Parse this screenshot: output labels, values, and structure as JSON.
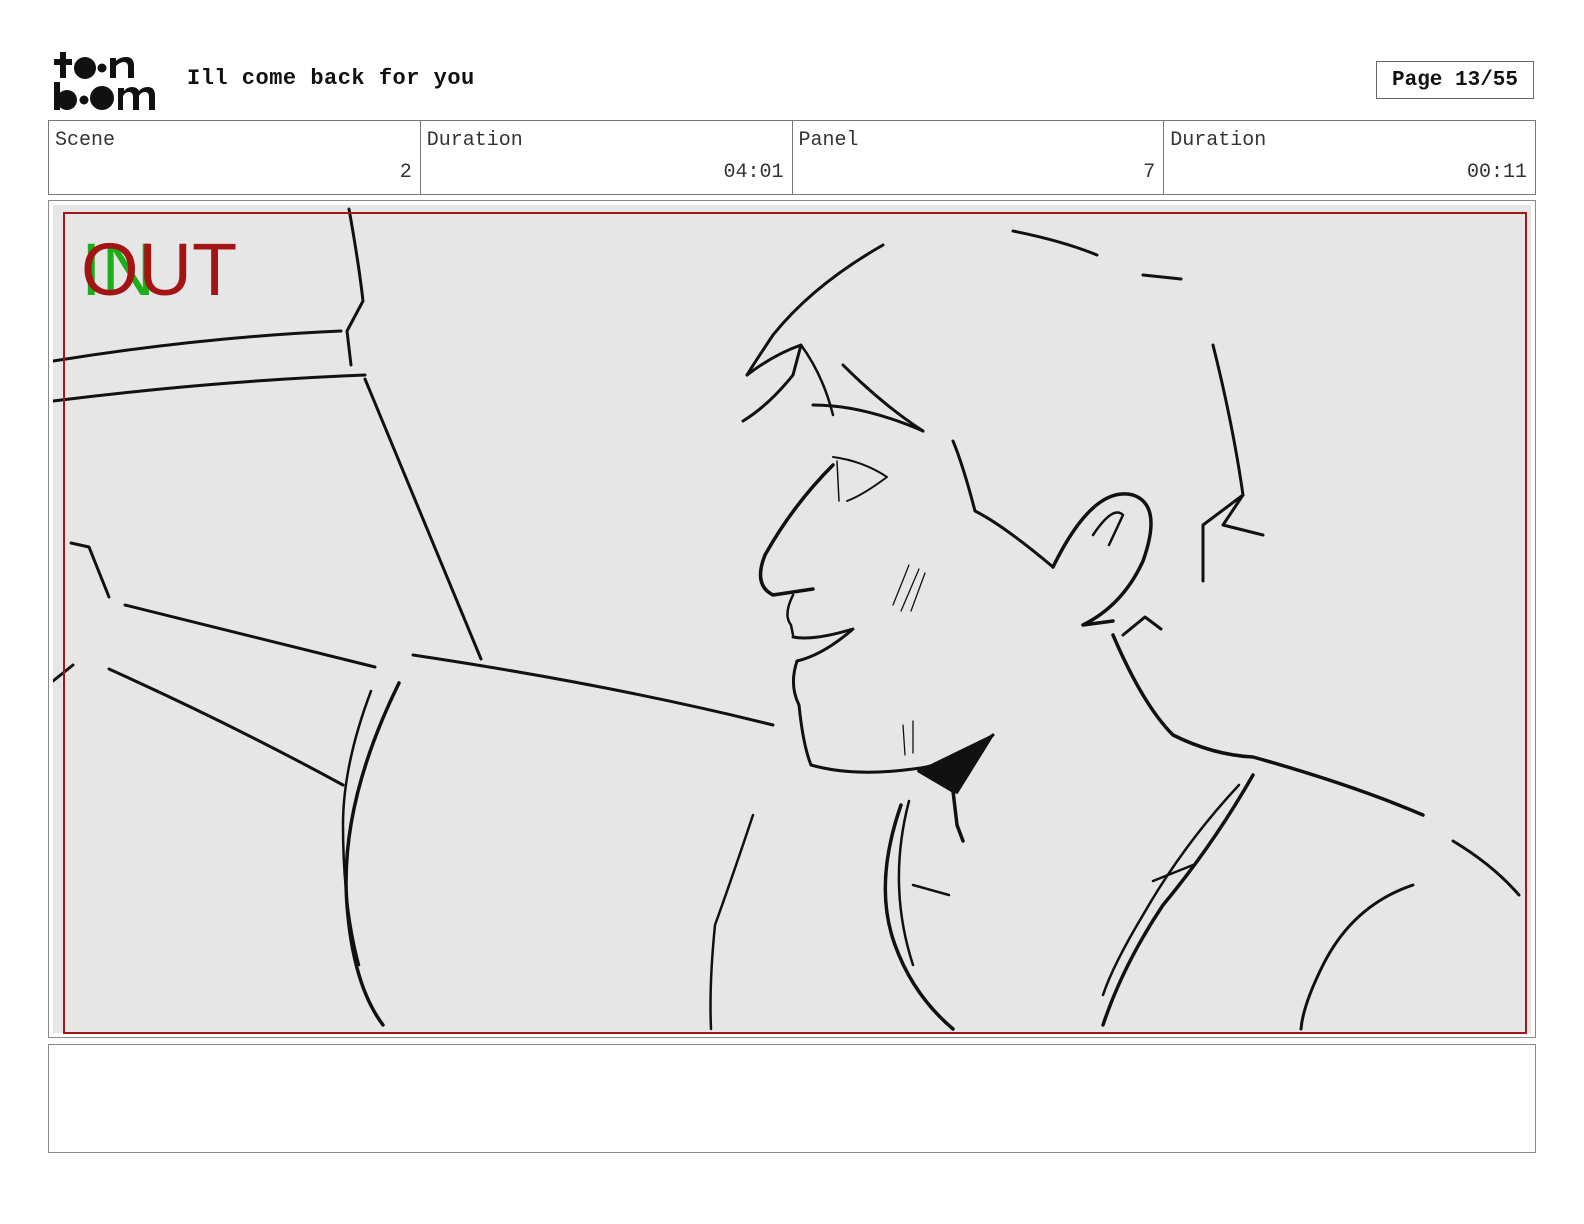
{
  "header": {
    "logo_text": "toon boom",
    "project_title": "Ill come back for you",
    "page_label": "Page 13/55"
  },
  "info": {
    "scene_label": "Scene",
    "scene_value": "2",
    "scene_duration_label": "Duration",
    "scene_duration_value": "04:01",
    "panel_label": "Panel",
    "panel_value": "7",
    "panel_duration_label": "Duration",
    "panel_duration_value": "00:11"
  },
  "panel": {
    "in_label": "IN",
    "out_label": "OUT",
    "frame_color": "#a01818",
    "in_color": "#19b019",
    "out_color": "#a31515",
    "background_color": "#e6e6e6"
  },
  "notes": {
    "text": ""
  }
}
